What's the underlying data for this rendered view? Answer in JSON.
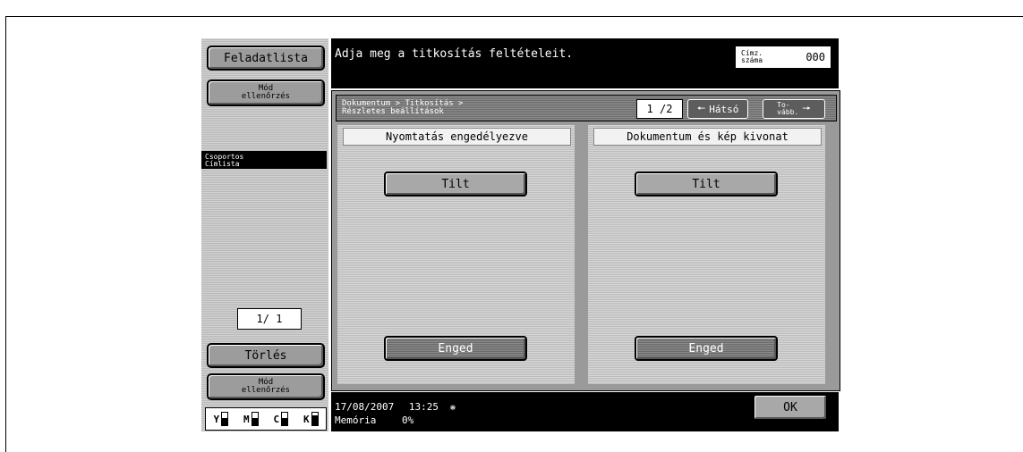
{
  "sidebar": {
    "feladatlista": "Feladatlista",
    "mod_top": "Mód\nellenőrzés",
    "csoportos": "Csoportos\nCímlista",
    "page": "1/ 1",
    "torles": "Törlés",
    "mod_bottom": "Mód\nellenőrzés"
  },
  "topbar": {
    "message": "Adja meg a titkosítás feltételeit.",
    "cimz_label": "Címz.\nszáma",
    "cimz_value": "000"
  },
  "header": {
    "breadcrumb": "Dokumentum > Titkosítás >\nRészletes beállítások",
    "page": "1 /2",
    "back": "Hátsó",
    "next": "To-\nvább."
  },
  "columns": [
    {
      "title": "Nyomtatás engedélyezve",
      "tilt": "Tilt",
      "enged": "Enged"
    },
    {
      "title": "Dokumentum és kép kivonat",
      "tilt": "Tilt",
      "enged": "Enged"
    }
  ],
  "status": {
    "date": "17/08/2007",
    "time": "13:25",
    "memory_label": "Memória",
    "memory_value": "0%"
  },
  "ok": "OK",
  "toner": [
    {
      "name": "Y",
      "level": 0.6
    },
    {
      "name": "M",
      "level": 0.6
    },
    {
      "name": "C",
      "level": 0.6
    },
    {
      "name": "K",
      "level": 0.8
    }
  ]
}
